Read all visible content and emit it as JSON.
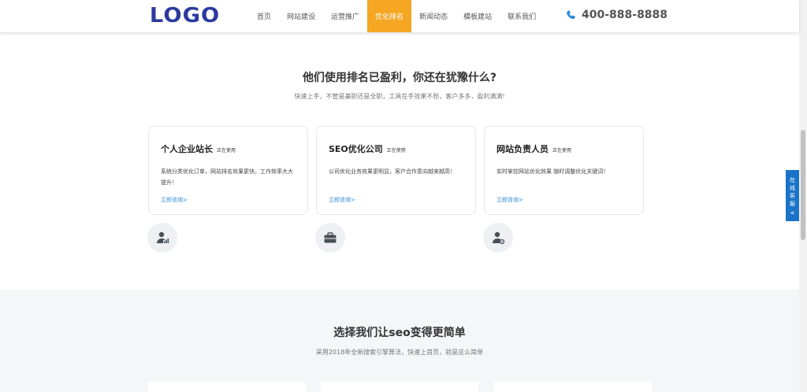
{
  "header": {
    "logo": "LOGO",
    "nav": [
      "首页",
      "网站建设",
      "运营推广",
      "优化排名",
      "新闻动态",
      "模板建站",
      "联系我们"
    ],
    "active_index": 3,
    "phone": "400-888-8888"
  },
  "section1": {
    "title": "他们使用排名已盈利，你还在犹豫什么?",
    "subtitle": "快速上手，不管是兼职还是全职，工具在手效果不愁，客户多多，盈利满满!",
    "cards": [
      {
        "title": "个人企业站长",
        "tag": "正在使用",
        "desc": "系统分类优化订单，网站排名效果更快，工作效率大大提升！",
        "link": "立即咨询>",
        "icon": "user-chart-icon"
      },
      {
        "title": "SEO优化公司",
        "tag": "正在使用",
        "desc": "公司优化业务效果更明显，客户合作意向越来越高！",
        "link": "立即咨询>",
        "icon": "briefcase-icon"
      },
      {
        "title": "网站负责人员",
        "tag": "正在使用",
        "desc": "实时掌控网站优化效果 随时调整优化关键词！",
        "link": "立即咨询>",
        "icon": "user-gear-icon"
      }
    ]
  },
  "section2": {
    "title": "选择我们让seo变得更简单",
    "subtitle": "采用2018年全新搜索引擎算法，快速上首页，就是这么简单"
  },
  "service": {
    "chars": [
      "在",
      "线",
      "客",
      "服"
    ],
    "arrow": "«",
    "color": "#1a73c8"
  },
  "colors": {
    "accent": "#f5a623",
    "logo": "#2b3a9e",
    "link": "#2a8ad8"
  }
}
